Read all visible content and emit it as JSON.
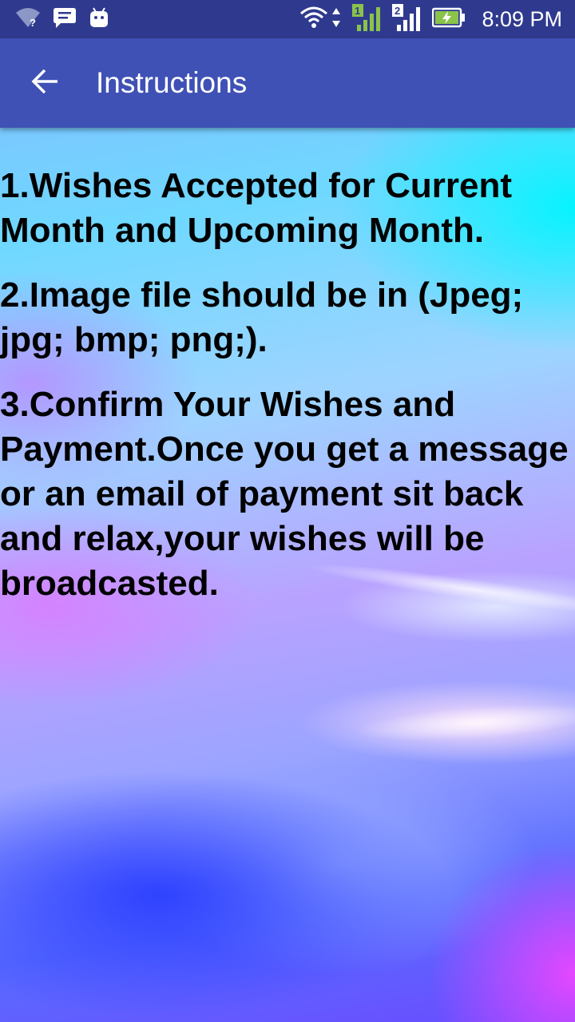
{
  "status_bar": {
    "time": "8:09 PM",
    "left_icons": [
      "wifi-question-icon",
      "message-icon",
      "android-icon"
    ],
    "right_icons": [
      "wifi-icon",
      "data-arrows-icon",
      "signal-sim1-icon",
      "signal-sim2-icon",
      "battery-charging-icon"
    ],
    "sim1_label": "1",
    "sim2_label": "2"
  },
  "toolbar": {
    "title": "Instructions",
    "back_icon": "arrow-back-icon",
    "color": "#3f51b5"
  },
  "instructions": [
    "1.Wishes Accepted for Current Month and Upcoming Month.",
    "2.Image file should be in (Jpeg; jpg; bmp; png;).",
    "3.Confirm Your Wishes and Payment.Once you get a message or an email of payment sit back and relax,your wishes will be broadcasted."
  ]
}
